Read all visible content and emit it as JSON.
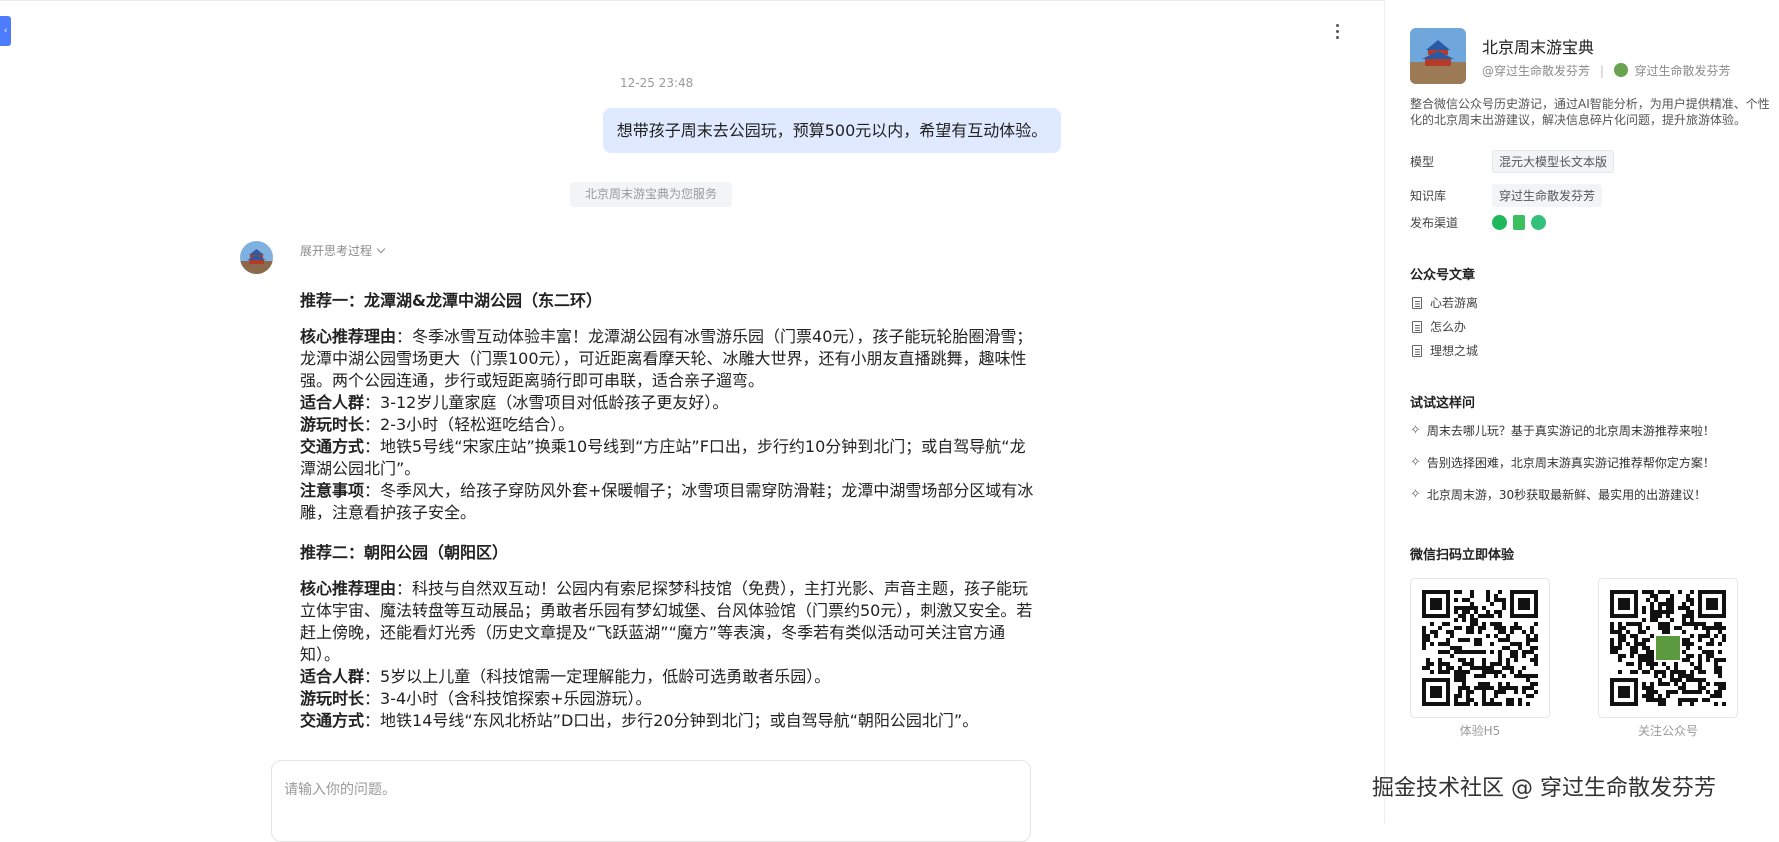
{
  "chat": {
    "timestamp": "12-25 23:48",
    "user_message": "想带孩子周末去公园玩，预算500元以内，希望有互动体验。",
    "system_tag": "北京周末游宝典为您服务",
    "think_toggle": "展开思考过程",
    "answer": {
      "rec1": {
        "title": "推荐一：龙潭湖&龙潭中湖公园（东二环）",
        "reason_k": "核心推荐理由",
        "reason_v": "：冬季冰雪互动体验丰富！龙潭湖公园有冰雪游乐园（门票40元），孩子能玩轮胎圈滑雪；龙潭中湖公园雪场更大（门票100元），可近距离看摩天轮、冰雕大世界，还有小朋友直播跳舞，趣味性强。两个公园连通，步行或短距离骑行即可串联，适合亲子遛弯。",
        "crowd_k": "适合人群",
        "crowd_v": "：3-12岁儿童家庭（冰雪项目对低龄孩子更友好）。",
        "time_k": "游玩时长",
        "time_v": "：2-3小时（轻松逛吃结合）。",
        "traffic_k": "交通方式",
        "traffic_v": "：地铁5号线“宋家庄站”换乘10号线到“方庄站”F口出，步行约10分钟到北门；或自驾导航“龙潭湖公园北门”。",
        "note_k": "注意事项",
        "note_v": "：冬季风大，给孩子穿防风外套+保暖帽子；冰雪项目需穿防滑鞋；龙潭中湖雪场部分区域有冰雕，注意看护孩子安全。"
      },
      "rec2": {
        "title": "推荐二：朝阳公园（朝阳区）",
        "reason_k": "核心推荐理由",
        "reason_v": "：科技与自然双互动！公园内有索尼探梦科技馆（免费），主打光影、声音主题，孩子能玩立体宇宙、魔法转盘等互动展品；勇敢者乐园有梦幻城堡、台风体验馆（门票约50元），刺激又安全。若赶上傍晚，还能看灯光秀（历史文章提及“飞跃蓝湖”“魔方”等表演，冬季若有类似活动可关注官方通知）。",
        "crowd_k": "适合人群",
        "crowd_v": "：5岁以上儿童（科技馆需一定理解能力，低龄可选勇敢者乐园）。",
        "time_k": "游玩时长",
        "time_v": "：3-4小时（含科技馆探索+乐园游玩）。",
        "traffic_k": "交通方式",
        "traffic_v": "：地铁14号线“东风北桥站”D口出，步行20分钟到北门；或自驾导航“朝阳公园北门”。"
      }
    },
    "input_placeholder": "请输入你的问题。"
  },
  "sidebar": {
    "app_name": "北京周末游宝典",
    "author_handle": "@穿过生命散发芬芳",
    "author_name": "穿过生命散发芬芳",
    "description": "整合微信公众号历史游记，通过AI智能分析，为用户提供精准、个性化的北京周末出游建议，解决信息碎片化问题，提升旅游体验。",
    "model_label": "模型",
    "model_value": "混元大模型长文本版",
    "kb_label": "知识库",
    "kb_value": "穿过生命散发芬芳",
    "channel_label": "发布渠道",
    "channel_colors": [
      "#1fb85a",
      "#3cbf5f",
      "#33c07a"
    ],
    "articles_title": "公众号文章",
    "articles": [
      "心若游离",
      "怎么办",
      "理想之城"
    ],
    "try_title": "试试这样问",
    "try_questions": [
      "周末去哪儿玩？基于真实游记的北京周末游推荐来啦！",
      "告别选择困难，北京周末游真实游记推荐帮你定方案！",
      "北京周末游，30秒获取最新鲜、最实用的出游建议！"
    ],
    "qr_title": "微信扫码立即体验",
    "qr_captions": [
      "体验H5",
      "关注公众号"
    ]
  },
  "watermark": "掘金技术社区 @ 穿过生命散发芬芳"
}
